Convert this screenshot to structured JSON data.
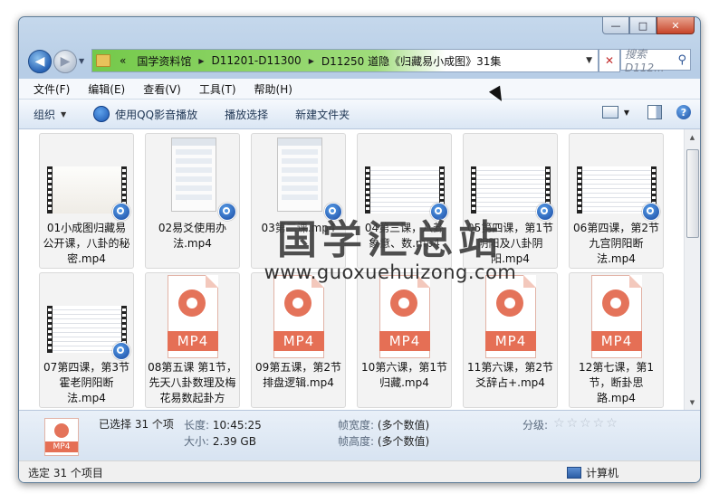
{
  "window": {
    "caption_buttons": [
      "—",
      "□",
      "✕"
    ]
  },
  "address": {
    "prefix": "«",
    "crumbs": [
      "国学资料馆",
      "D11201-D11300",
      "D11250 道隐《归藏易小成图》31集"
    ],
    "search_placeholder": "搜索 D112...",
    "highlight_color": "#7fcf5a"
  },
  "menu": [
    "文件(F)",
    "编辑(E)",
    "查看(V)",
    "工具(T)",
    "帮助(H)"
  ],
  "toolbar": {
    "organize": "组织",
    "qq_play": "使用QQ影音播放",
    "play_selection": "播放选择",
    "new_folder": "新建文件夹"
  },
  "files": [
    {
      "name": "01小成图归藏易公开课，八卦的秘密.mp4",
      "thumb": "video-ink"
    },
    {
      "name": "02易爻使用办法.mp4",
      "thumb": "phone"
    },
    {
      "name": "03第二课.mp4",
      "thumb": "phone"
    },
    {
      "name": "04第三课，八卦象意、数.mp4",
      "thumb": "video-lines"
    },
    {
      "name": "05第四课，第1节阴阳及八卦阴阳.mp4",
      "thumb": "video-lines"
    },
    {
      "name": "06第四课，第2节九宫阴阳断法.mp4",
      "thumb": "video-lines"
    },
    {
      "name": "07第四课，第3节霍老阴阳断法.mp4",
      "thumb": "video-lines"
    },
    {
      "name": "08第五课 第1节，先天八卦数理及梅花易数起卦方法.mp4",
      "thumb": "mp4"
    },
    {
      "name": "09第五课，第2节排盘逻辑.mp4",
      "thumb": "mp4"
    },
    {
      "name": "10第六课，第1节归藏.mp4",
      "thumb": "mp4"
    },
    {
      "name": "11第六课，第2节爻辞占+.mp4",
      "thumb": "mp4"
    },
    {
      "name": "12第七课，第1节，断卦思路.mp4",
      "thumb": "mp4"
    }
  ],
  "mp4_label": "MP4",
  "watermark": {
    "title": "国学汇总站",
    "url": "www.guoxuehuizong.com"
  },
  "details": {
    "selected": "已选择 31 个项",
    "length_label": "长度:",
    "length_value": "10:45:25",
    "size_label": "大小:",
    "size_value": "2.39 GB",
    "width_label": "帧宽度:",
    "width_value": "(多个数值)",
    "height_label": "帧高度:",
    "height_value": "(多个数值)",
    "rating_label": "分级:",
    "rating_stars": "☆☆☆☆☆",
    "icon_label": "MP4"
  },
  "status": {
    "left": "选定 31 个项目",
    "right": "计算机"
  }
}
